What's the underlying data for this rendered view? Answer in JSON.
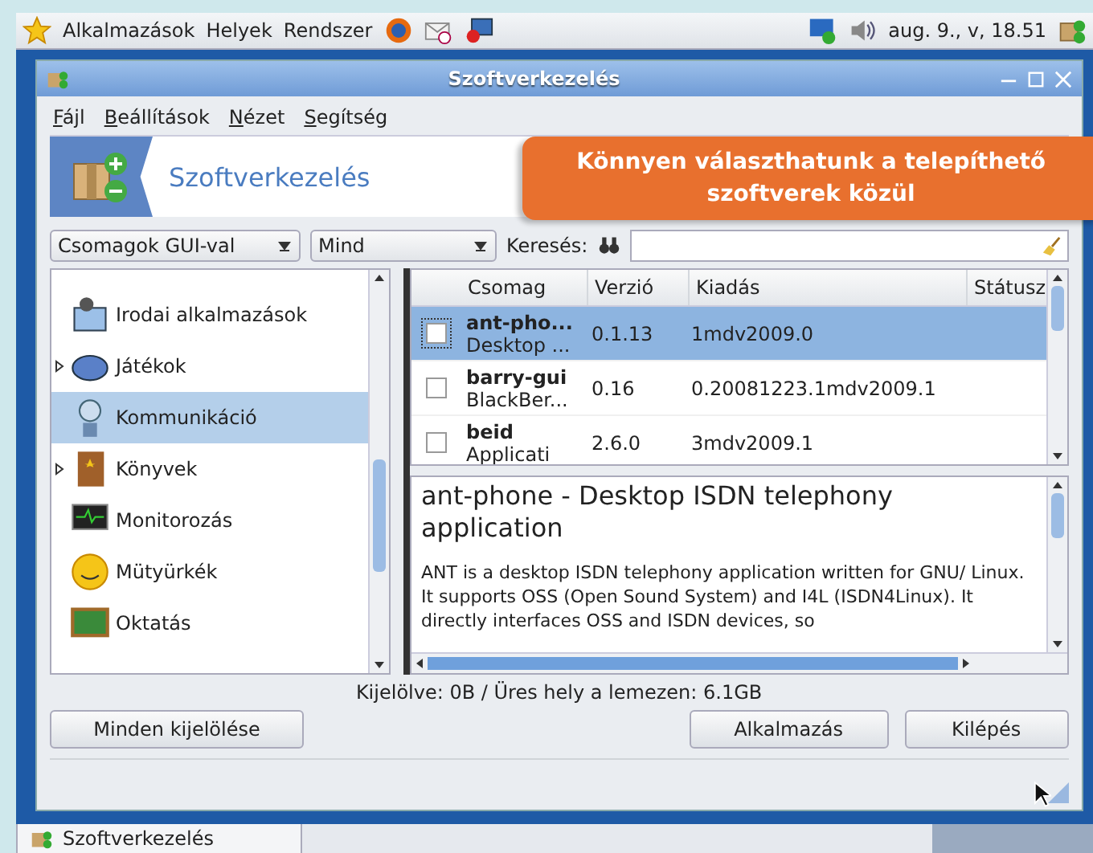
{
  "top_panel": {
    "menus": [
      "Alkalmazások",
      "Helyek",
      "Rendszer"
    ],
    "clock": "aug. 9., v, 18.51"
  },
  "window": {
    "title": "Szoftverkezelés"
  },
  "menu_bar": [
    "Fájl",
    "Beállítások",
    "Nézet",
    "Segítség"
  ],
  "header": {
    "title": "Szoftverkezelés"
  },
  "callout": "Könnyen választhatunk a telepíthető szoftverek közül",
  "filters": {
    "group": "Csomagok GUI-val",
    "status": "Mind",
    "search_label": "Keresés:"
  },
  "categories": [
    {
      "label": "Irodai alkalmazások",
      "has_children": false,
      "selected": false
    },
    {
      "label": "Játékok",
      "has_children": true,
      "selected": false
    },
    {
      "label": "Kommunikáció",
      "has_children": false,
      "selected": true
    },
    {
      "label": "Könyvek",
      "has_children": true,
      "selected": false
    },
    {
      "label": "Monitorozás",
      "has_children": false,
      "selected": false
    },
    {
      "label": "Mütyürkék",
      "has_children": false,
      "selected": false
    },
    {
      "label": "Oktatás",
      "has_children": false,
      "selected": false
    }
  ],
  "table": {
    "columns": [
      "Csomag",
      "Verzió",
      "Kiadás",
      "Státusz"
    ],
    "rows": [
      {
        "name": "ant-pho...",
        "summary": "Desktop ...",
        "version": "0.1.13",
        "release": "1mdv2009.0",
        "selected": true,
        "checked": false
      },
      {
        "name": "barry-gui",
        "summary": "BlackBer...",
        "version": "0.16",
        "release": "0.20081223.1mdv2009.1",
        "selected": false,
        "checked": false
      },
      {
        "name": "beid",
        "summary": "Applicati",
        "version": "2.6.0",
        "release": "3mdv2009.1",
        "selected": false,
        "checked": false
      }
    ]
  },
  "description": {
    "title": "ant-phone - Desktop ISDN telephony application",
    "body": "ANT is a desktop ISDN telephony application written for GNU/ Linux. It supports OSS (Open Sound System) and I4L (ISDN4Linux).  It directly interfaces OSS and ISDN devices, so"
  },
  "status": "Kijelölve: 0B / Üres hely a lemezen: 6.1GB",
  "buttons": [
    "Minden kijelölése",
    "Alkalmazás",
    "Kilépés"
  ],
  "taskbar": {
    "task": "Szoftverkezelés"
  }
}
